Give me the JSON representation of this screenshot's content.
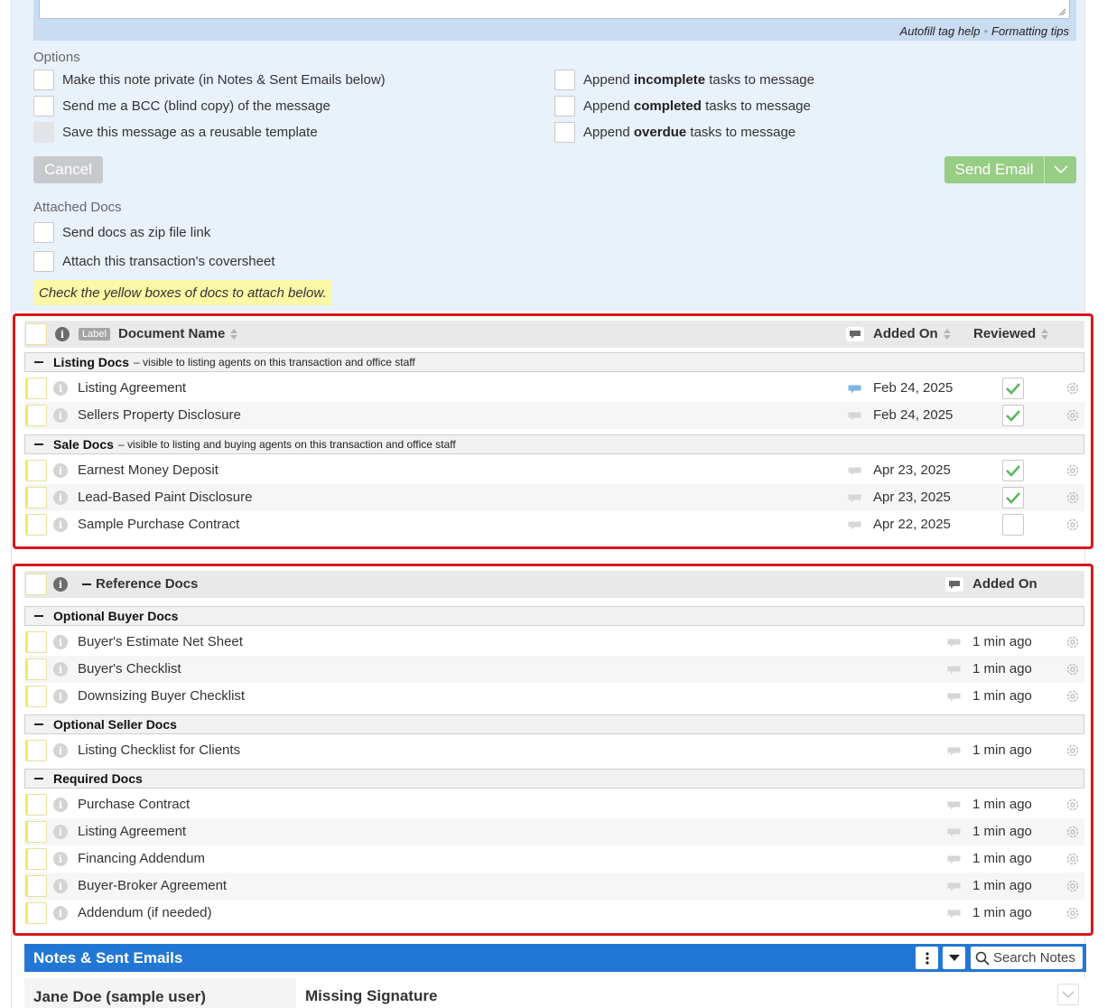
{
  "compose": {
    "help_links": {
      "autofill": "Autofill tag help",
      "separator": "•",
      "formatting": "Formatting tips"
    },
    "options_title": "Options",
    "options_left": [
      {
        "label": "Make this note private (in Notes & Sent Emails below)",
        "checked": false,
        "disabled": false
      },
      {
        "label": "Send me a BCC (blind copy) of the message",
        "checked": false,
        "disabled": false
      },
      {
        "label": "Save this message as a reusable template",
        "checked": false,
        "disabled": true
      }
    ],
    "options_right": [
      {
        "prefix": "Append ",
        "bold": "incomplete",
        "suffix": " tasks to message"
      },
      {
        "prefix": "Append ",
        "bold": "completed",
        "suffix": " tasks to message"
      },
      {
        "prefix": "Append ",
        "bold": "overdue",
        "suffix": " tasks to message"
      }
    ],
    "cancel_label": "Cancel",
    "send_label": "Send Email",
    "attached_title": "Attached Docs",
    "attach_options": [
      {
        "label": "Send docs as zip file link"
      },
      {
        "label": "Attach this transaction's coversheet"
      }
    ],
    "yellow_note": "Check the yellow boxes of docs to attach below."
  },
  "transaction_docs": {
    "header": {
      "label_badge": "Label",
      "name_col": "Document Name",
      "added_col": "Added On",
      "reviewed_col": "Reviewed"
    },
    "groups": [
      {
        "title": "Listing Docs",
        "desc": "– visible to listing agents on this transaction and office staff",
        "docs": [
          {
            "name": "Listing Agreement",
            "added": "Feb 24, 2025",
            "reviewed": true,
            "has_comment": true
          },
          {
            "name": "Sellers Property Disclosure",
            "added": "Feb 24, 2025",
            "reviewed": true,
            "has_comment": false
          }
        ]
      },
      {
        "title": "Sale Docs",
        "desc": "– visible to listing and buying agents on this transaction and office staff",
        "docs": [
          {
            "name": "Earnest Money Deposit",
            "added": "Apr 23, 2025",
            "reviewed": true,
            "has_comment": false
          },
          {
            "name": "Lead-Based Paint Disclosure",
            "added": "Apr 23, 2025",
            "reviewed": true,
            "has_comment": false
          },
          {
            "name": "Sample Purchase Contract",
            "added": "Apr 22, 2025",
            "reviewed": false,
            "has_comment": false
          }
        ]
      }
    ]
  },
  "reference_docs": {
    "header": {
      "title": "Reference Docs",
      "added_col": "Added On"
    },
    "groups": [
      {
        "title": "Optional Buyer Docs",
        "docs": [
          {
            "name": "Buyer's Estimate Net Sheet",
            "added": "1 min ago"
          },
          {
            "name": "Buyer's Checklist",
            "added": "1 min ago"
          },
          {
            "name": "Downsizing Buyer Checklist",
            "added": "1 min ago"
          }
        ]
      },
      {
        "title": "Optional Seller Docs",
        "docs": [
          {
            "name": "Listing Checklist for Clients",
            "added": "1 min ago"
          }
        ]
      },
      {
        "title": "Required Docs",
        "docs": [
          {
            "name": "Purchase Contract",
            "added": "1 min ago"
          },
          {
            "name": "Listing Agreement",
            "added": "1 min ago"
          },
          {
            "name": "Financing Addendum",
            "added": "1 min ago"
          },
          {
            "name": "Buyer-Broker Agreement",
            "added": "1 min ago"
          },
          {
            "name": "Addendum (if needed)",
            "added": "1 min ago"
          }
        ]
      }
    ]
  },
  "notes": {
    "title": "Notes & Sent Emails",
    "search_placeholder": "Search Notes",
    "entries": [
      {
        "author": "Jane Doe (sample user)",
        "subject": "Missing Signature"
      }
    ]
  },
  "colors": {
    "accent_blue": "#2277d4",
    "send_green": "#97cd84",
    "highlight_red": "#d7191e",
    "note_yellow": "#fbf8a6",
    "check_green": "#5cb85c"
  },
  "icons": {
    "info": "info-icon",
    "comment": "comment-bubble-icon",
    "settings": "gear-icon",
    "check": "checkmark-icon",
    "search": "search-icon",
    "menu": "kebab-menu-icon",
    "dropdown": "caret-down-icon",
    "collapse": "minus-icon"
  }
}
